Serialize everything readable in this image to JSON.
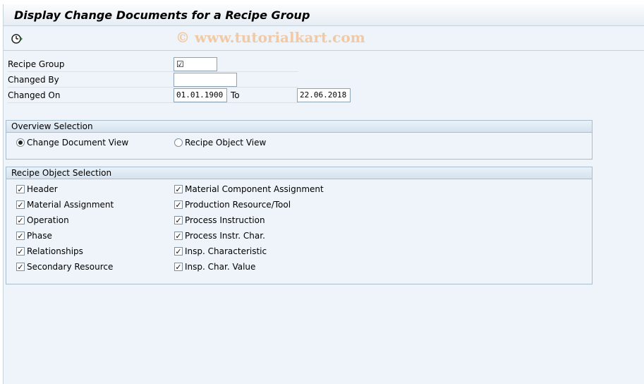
{
  "title": "Display Change Documents for a Recipe Group",
  "watermark": "© www.tutorialkart.com",
  "toolbar": {
    "execute_icon": "clock-execute-icon"
  },
  "form": {
    "recipe_group": {
      "label": "Recipe Group",
      "value": "☑"
    },
    "changed_by": {
      "label": "Changed By",
      "value": ""
    },
    "changed_on": {
      "label": "Changed On",
      "from": "01.01.1900",
      "to_label": "To",
      "to": "22.06.2018"
    }
  },
  "overview_selection": {
    "title": "Overview Selection",
    "options": [
      {
        "label": "Change Document View",
        "selected": true
      },
      {
        "label": "Recipe Object View",
        "selected": false
      }
    ]
  },
  "recipe_object_selection": {
    "title": "Recipe Object Selection",
    "left": [
      {
        "label": "Header",
        "checked": true
      },
      {
        "label": "Material Assignment",
        "checked": true
      },
      {
        "label": "Operation",
        "checked": true
      },
      {
        "label": "Phase",
        "checked": true
      },
      {
        "label": "Relationships",
        "checked": true
      },
      {
        "label": "Secondary Resource",
        "checked": true
      }
    ],
    "right": [
      {
        "label": "Material Component Assignment",
        "checked": true
      },
      {
        "label": "Production Resource/Tool",
        "checked": true
      },
      {
        "label": "Process Instruction",
        "checked": true
      },
      {
        "label": "Process Instr. Char.",
        "checked": true
      },
      {
        "label": "Insp. Characteristic",
        "checked": true
      },
      {
        "label": "Insp. Char. Value",
        "checked": true
      }
    ]
  },
  "colors": {
    "background": "#eef4f9",
    "border": "#a9bccb",
    "watermark": "#f0c9a6"
  }
}
